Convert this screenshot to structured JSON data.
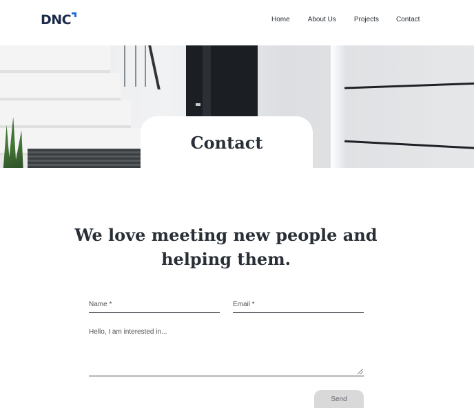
{
  "header": {
    "logo_text": "DNC",
    "nav": [
      {
        "label": "Home"
      },
      {
        "label": "About Us"
      },
      {
        "label": "Projects"
      },
      {
        "label": "Contact"
      }
    ]
  },
  "hero": {
    "title": "Contact"
  },
  "main": {
    "heading_line1": "We love meeting new people and",
    "heading_line2": "helping them."
  },
  "form": {
    "name_placeholder": "Name *",
    "email_placeholder": "Email *",
    "message_placeholder": "Hello, I am interested in...",
    "send_label": "Send"
  },
  "colors": {
    "text": "#292f36",
    "logo_accent": "#1e6fd9",
    "button_bg": "#d9d9d9"
  }
}
